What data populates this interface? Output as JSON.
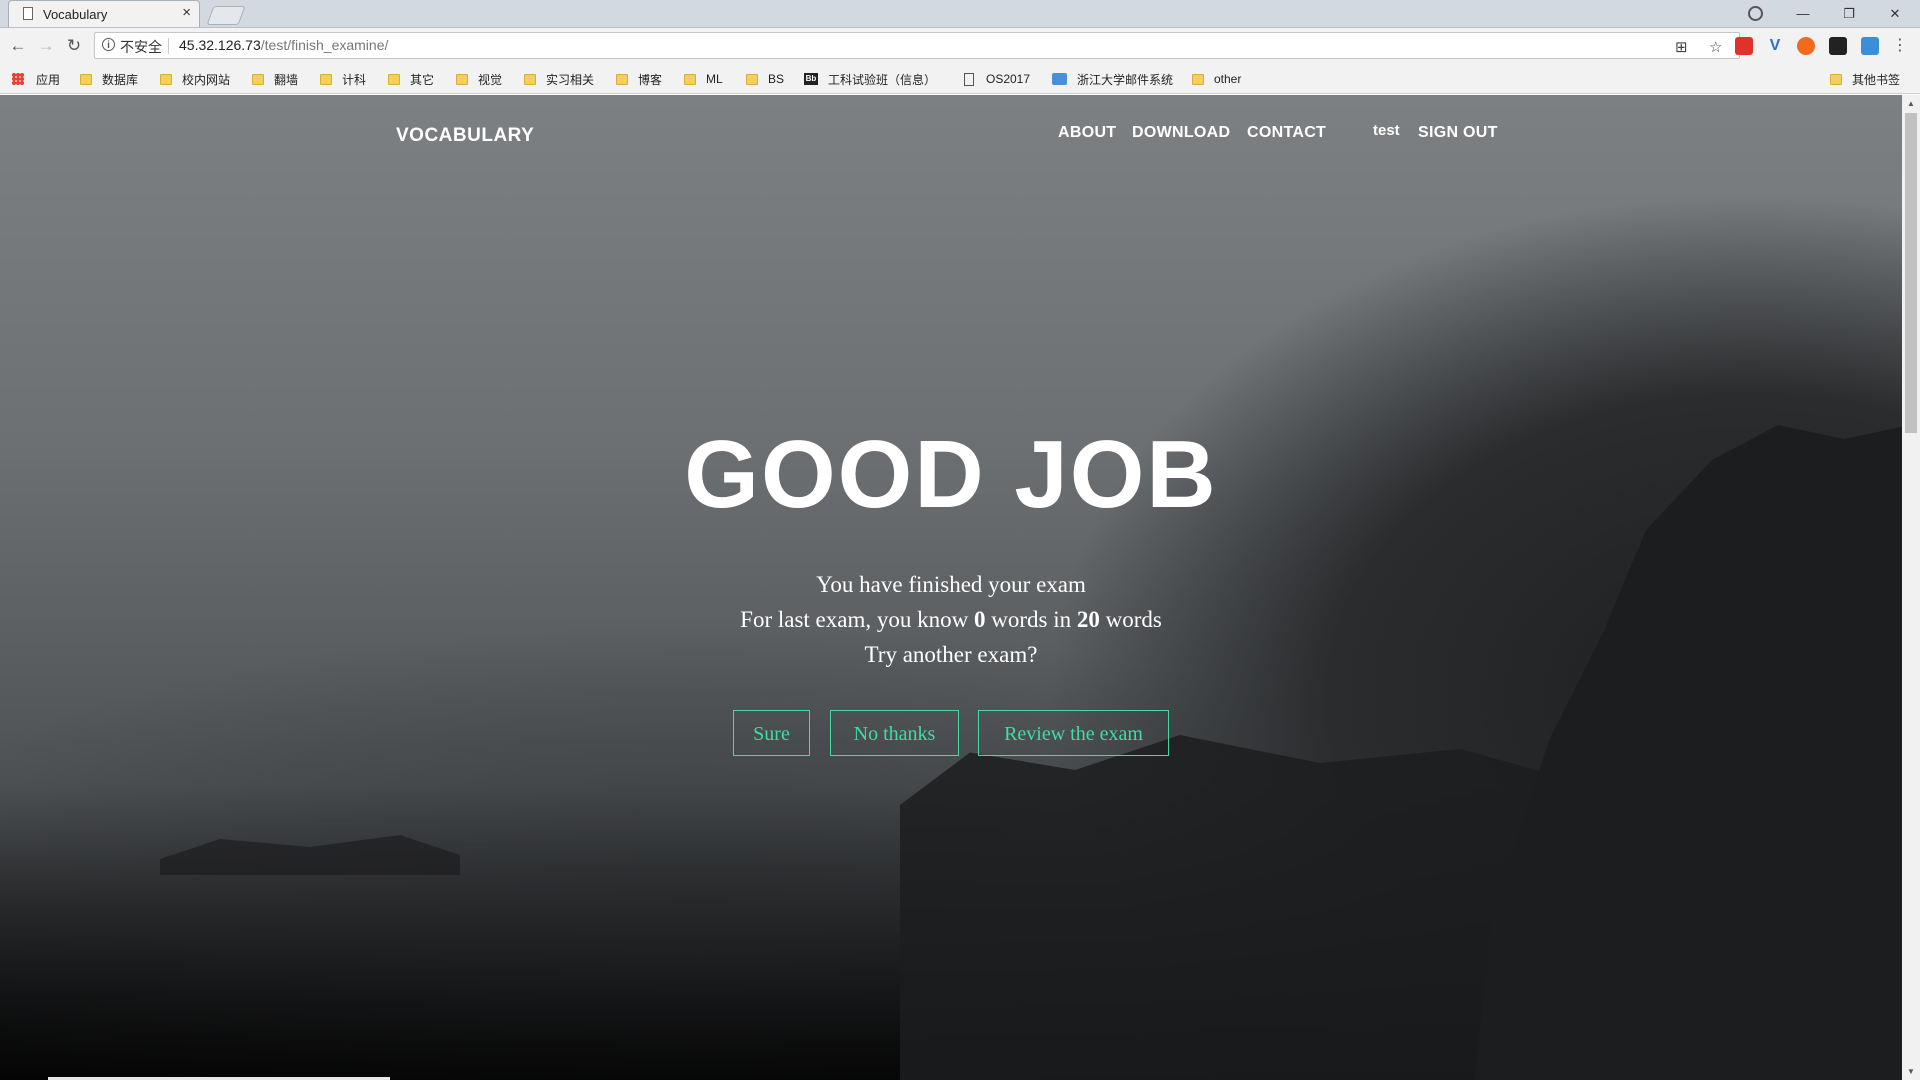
{
  "browser": {
    "tab_title": "Vocabulary",
    "tab_close": "×",
    "window_controls": {
      "minimize": "—",
      "restore": "❐",
      "close": "✕"
    },
    "nav": {
      "back": "←",
      "forward": "→",
      "reload": "↻"
    },
    "address": {
      "info_icon": "i",
      "security_label": "不安全",
      "host": "45.32.126.73",
      "path": "/test/finish_examine/"
    },
    "omnibox_icons": {
      "translate": "⊞",
      "bookmark_star": "☆"
    },
    "menu_icon": "⋮",
    "bookmarks": [
      {
        "label": "应用",
        "icon": "apps-icon"
      },
      {
        "label": "数据库",
        "icon": "folder-icon"
      },
      {
        "label": "校内网站",
        "icon": "folder-icon"
      },
      {
        "label": "翻墙",
        "icon": "folder-icon"
      },
      {
        "label": "计科",
        "icon": "folder-icon"
      },
      {
        "label": "其它",
        "icon": "folder-icon"
      },
      {
        "label": "视觉",
        "icon": "folder-icon"
      },
      {
        "label": "实习相关",
        "icon": "folder-icon"
      },
      {
        "label": "博客",
        "icon": "folder-icon"
      },
      {
        "label": "ML",
        "icon": "folder-icon"
      },
      {
        "label": "BS",
        "icon": "folder-icon"
      },
      {
        "label": "工科试验班（信息）",
        "icon": "bb-icon",
        "icon_text": "Bb"
      },
      {
        "label": "OS2017",
        "icon": "document-icon"
      },
      {
        "label": "浙江大学邮件系统",
        "icon": "mail-icon"
      },
      {
        "label": "other",
        "icon": "folder-icon"
      }
    ],
    "other_bookmarks": "其他书签"
  },
  "page": {
    "brand": "VOCABULARY",
    "nav_links": [
      "ABOUT",
      "DOWNLOAD",
      "CONTACT"
    ],
    "username": "test",
    "sign_out": "SIGN OUT",
    "headline": "GOOD JOB",
    "line1": "You have finished your exam",
    "line2": {
      "prefix": "For last exam, you know ",
      "known": "0",
      "middle": " words in ",
      "total": "20",
      "suffix": " words"
    },
    "line3": "Try another exam?",
    "buttons": {
      "sure": "Sure",
      "no_thanks": "No thanks",
      "review": "Review the exam"
    },
    "accent_color": "#42dca3"
  }
}
